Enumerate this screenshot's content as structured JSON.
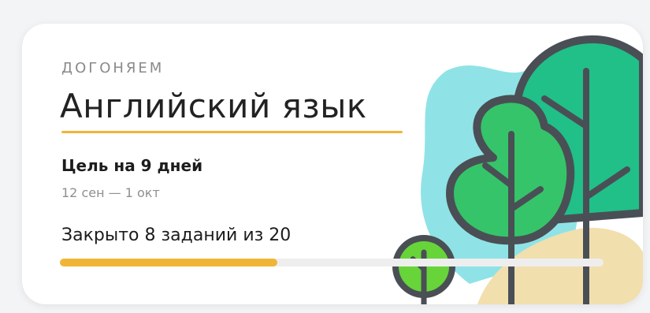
{
  "card": {
    "eyebrow": "ДОГОНЯЕМ",
    "title": "Английский язык",
    "goal": "Цель на 9 дней",
    "dates": "12 сен — 1 окт",
    "progress_text": "Закрыто 8 заданий из 20",
    "progress": {
      "done": 8,
      "total": 20
    }
  },
  "colors": {
    "accent": "#f0b537",
    "tree_light_green": "#67d43a",
    "tree_green": "#35c46a",
    "tree_teal": "#20c088",
    "sky": "#8fe3e6",
    "outline": "#4a4f55"
  },
  "illustration": {
    "icon": "forest-trees-illustration"
  }
}
